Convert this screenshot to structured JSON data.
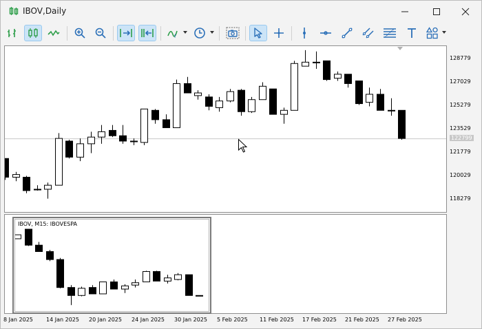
{
  "window": {
    "title": "IBOV,Daily"
  },
  "toolbar": {
    "buttons": [
      {
        "name": "bar-chart-icon",
        "active": false
      },
      {
        "name": "candlestick-chart-icon",
        "active": true
      },
      {
        "name": "line-chart-icon",
        "active": false
      },
      {
        "name": "zoom-in-icon",
        "active": false
      },
      {
        "name": "zoom-out-icon",
        "active": false
      },
      {
        "name": "chart-shift-icon",
        "active": true
      },
      {
        "name": "autoscroll-icon",
        "active": true
      },
      {
        "name": "indicators-icon",
        "active": false
      },
      {
        "name": "periods-clock-icon",
        "active": false
      },
      {
        "name": "screenshot-icon",
        "active": false
      },
      {
        "name": "cursor-icon",
        "active": true
      },
      {
        "name": "crosshair-icon",
        "active": false
      },
      {
        "name": "vertical-line-icon",
        "active": false
      },
      {
        "name": "horizontal-line-icon",
        "active": false
      },
      {
        "name": "trendline-icon",
        "active": false
      },
      {
        "name": "equidistant-channel-icon",
        "active": false
      },
      {
        "name": "fibonacci-retracement-icon",
        "active": false
      },
      {
        "name": "text-icon",
        "active": false
      },
      {
        "name": "shapes-icon",
        "active": false
      }
    ]
  },
  "price_axis": {
    "labels": [
      "128779",
      "127029",
      "125279",
      "123529",
      "121779",
      "120029",
      "118279"
    ],
    "current_price": "122799"
  },
  "time_axis": {
    "labels": [
      "8 Jan 2025",
      "14 Jan 2025",
      "20 Jan 2025",
      "24 Jan 2025",
      "30 Jan 2025",
      "5 Feb 2025",
      "11 Feb 2025",
      "17 Feb 2025",
      "21 Feb 2025",
      "27 Feb 2025"
    ]
  },
  "subwindow": {
    "label": "IBOV, M15:  IBOVESPA"
  },
  "colors": {
    "bull": "#ffffff",
    "bear": "#000000",
    "grid_price_line": "#c8c8c8"
  },
  "chart_data": [
    {
      "type": "candlestick",
      "title": "IBOV,Daily",
      "ylim": [
        117300,
        129700
      ],
      "candles": [
        {
          "o": 121300,
          "h": 121300,
          "l": 119700,
          "c": 119900
        },
        {
          "o": 119900,
          "h": 120300,
          "l": 119600,
          "c": 120100
        },
        {
          "o": 119900,
          "h": 120000,
          "l": 118700,
          "c": 118900
        },
        {
          "o": 119000,
          "h": 119300,
          "l": 118900,
          "c": 119000
        },
        {
          "o": 119000,
          "h": 119500,
          "l": 118300,
          "c": 119300
        },
        {
          "o": 119300,
          "h": 123200,
          "l": 119300,
          "c": 122800
        },
        {
          "o": 122600,
          "h": 122700,
          "l": 121300,
          "c": 121400
        },
        {
          "o": 121400,
          "h": 122800,
          "l": 121100,
          "c": 122400
        },
        {
          "o": 122400,
          "h": 123300,
          "l": 121700,
          "c": 122900
        },
        {
          "o": 122900,
          "h": 123800,
          "l": 122400,
          "c": 123300
        },
        {
          "o": 123400,
          "h": 123800,
          "l": 122900,
          "c": 123000
        },
        {
          "o": 123000,
          "h": 123800,
          "l": 122400,
          "c": 122600
        },
        {
          "o": 122600,
          "h": 122800,
          "l": 122300,
          "c": 122600
        },
        {
          "o": 122500,
          "h": 125000,
          "l": 122300,
          "c": 125000
        },
        {
          "o": 124900,
          "h": 125000,
          "l": 123900,
          "c": 124200
        },
        {
          "o": 124200,
          "h": 124600,
          "l": 123600,
          "c": 123600
        },
        {
          "o": 123600,
          "h": 127200,
          "l": 123600,
          "c": 126900
        },
        {
          "o": 126900,
          "h": 127400,
          "l": 126200,
          "c": 126200
        },
        {
          "o": 126000,
          "h": 126400,
          "l": 125700,
          "c": 126200
        },
        {
          "o": 125900,
          "h": 126100,
          "l": 124900,
          "c": 125200
        },
        {
          "o": 125100,
          "h": 125900,
          "l": 124800,
          "c": 125600
        },
        {
          "o": 125600,
          "h": 126500,
          "l": 125500,
          "c": 126300
        },
        {
          "o": 126400,
          "h": 126500,
          "l": 124500,
          "c": 124800
        },
        {
          "o": 124800,
          "h": 125900,
          "l": 124700,
          "c": 125700
        },
        {
          "o": 125700,
          "h": 127000,
          "l": 125700,
          "c": 126700
        },
        {
          "o": 126500,
          "h": 126500,
          "l": 124600,
          "c": 124600
        },
        {
          "o": 124600,
          "h": 125100,
          "l": 123900,
          "c": 124900
        },
        {
          "o": 124900,
          "h": 128600,
          "l": 124900,
          "c": 128400
        },
        {
          "o": 128200,
          "h": 129400,
          "l": 128200,
          "c": 128500
        },
        {
          "o": 128500,
          "h": 129300,
          "l": 128000,
          "c": 128500
        },
        {
          "o": 128600,
          "h": 128600,
          "l": 127100,
          "c": 127200
        },
        {
          "o": 127300,
          "h": 127800,
          "l": 127100,
          "c": 127600
        },
        {
          "o": 127600,
          "h": 127600,
          "l": 126600,
          "c": 126900
        },
        {
          "o": 127100,
          "h": 127100,
          "l": 125300,
          "c": 125400
        },
        {
          "o": 125500,
          "h": 126600,
          "l": 125200,
          "c": 126100
        },
        {
          "o": 126100,
          "h": 126500,
          "l": 124900,
          "c": 124900
        },
        {
          "o": 124900,
          "h": 125800,
          "l": 124500,
          "c": 124900
        },
        {
          "o": 124900,
          "h": 124900,
          "l": 122700,
          "c": 122800
        }
      ]
    },
    {
      "type": "candlestick",
      "title": "IBOV, M15:  IBOVESPA",
      "candles": [
        {
          "o": 0.88,
          "h": 0.88,
          "l": 0.93,
          "c": 0.93
        },
        {
          "o": 1.0,
          "h": 1.0,
          "l": 0.79,
          "c": 0.8
        },
        {
          "o": 0.8,
          "h": 0.84,
          "l": 0.72,
          "c": 0.72
        },
        {
          "o": 0.72,
          "h": 0.74,
          "l": 0.6,
          "c": 0.62
        },
        {
          "o": 0.62,
          "h": 0.64,
          "l": 0.26,
          "c": 0.27
        },
        {
          "o": 0.27,
          "h": 0.3,
          "l": 0.05,
          "c": 0.17
        },
        {
          "o": 0.17,
          "h": 0.28,
          "l": 0.16,
          "c": 0.26
        },
        {
          "o": 0.27,
          "h": 0.3,
          "l": 0.19,
          "c": 0.19
        },
        {
          "o": 0.19,
          "h": 0.34,
          "l": 0.19,
          "c": 0.34
        },
        {
          "o": 0.34,
          "h": 0.37,
          "l": 0.25,
          "c": 0.25
        },
        {
          "o": 0.25,
          "h": 0.31,
          "l": 0.2,
          "c": 0.29
        },
        {
          "o": 0.3,
          "h": 0.37,
          "l": 0.27,
          "c": 0.33
        },
        {
          "o": 0.34,
          "h": 0.48,
          "l": 0.34,
          "c": 0.47
        },
        {
          "o": 0.47,
          "h": 0.48,
          "l": 0.35,
          "c": 0.35
        },
        {
          "o": 0.35,
          "h": 0.43,
          "l": 0.32,
          "c": 0.39
        },
        {
          "o": 0.37,
          "h": 0.45,
          "l": 0.36,
          "c": 0.43
        },
        {
          "o": 0.43,
          "h": 0.43,
          "l": 0.17,
          "c": 0.17
        },
        {
          "o": 0.17,
          "h": 0.17,
          "l": 0.17,
          "c": 0.17
        }
      ]
    }
  ]
}
